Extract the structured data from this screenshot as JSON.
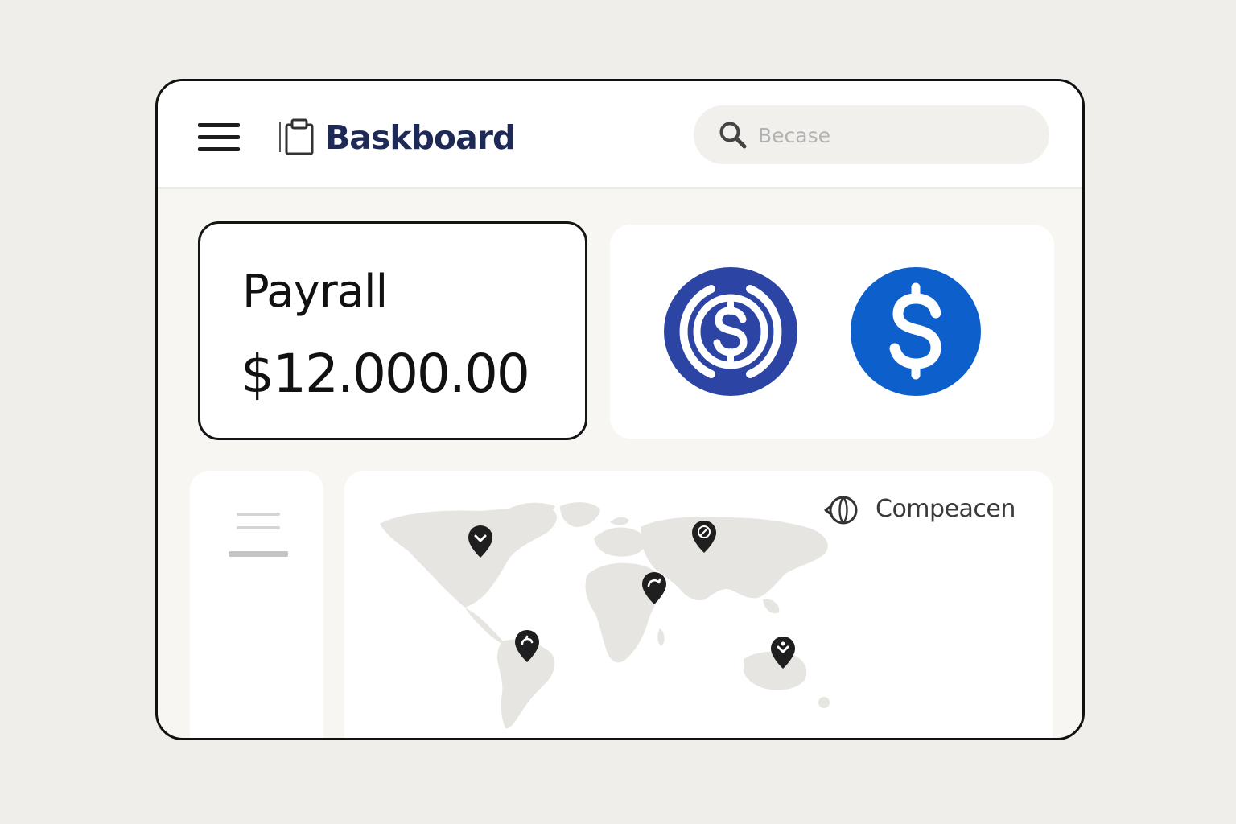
{
  "header": {
    "title": "Baskboard",
    "menu_icon": "hamburger-menu-icon",
    "logo_icon": "clipboard-icon"
  },
  "search": {
    "placeholder": "Becase",
    "value": "",
    "icon": "search-icon"
  },
  "payroll": {
    "label": "Payrall",
    "amount": "$12.000.00"
  },
  "coins": [
    {
      "icon": "usd-coin-ring-icon",
      "color": "#2c44a3"
    },
    {
      "icon": "usd-coin-icon",
      "color": "#0d5fcc"
    }
  ],
  "map": {
    "compare_label": "Compeacen",
    "compare_icon": "globe-compare-icon",
    "pins": [
      {
        "icon": "map-pin-icon",
        "region": "North America"
      },
      {
        "icon": "map-pin-icon",
        "region": "Northern Asia"
      },
      {
        "icon": "map-pin-icon",
        "region": "Africa"
      },
      {
        "icon": "map-pin-icon",
        "region": "South America"
      },
      {
        "icon": "map-pin-icon",
        "region": "Australia"
      }
    ]
  },
  "colors": {
    "brand": "#1e2a55",
    "coin_ring": "#2c44a3",
    "coin_solid": "#0d5fcc",
    "map_land": "#e6e5e1",
    "page_background": "#efeeeb"
  }
}
